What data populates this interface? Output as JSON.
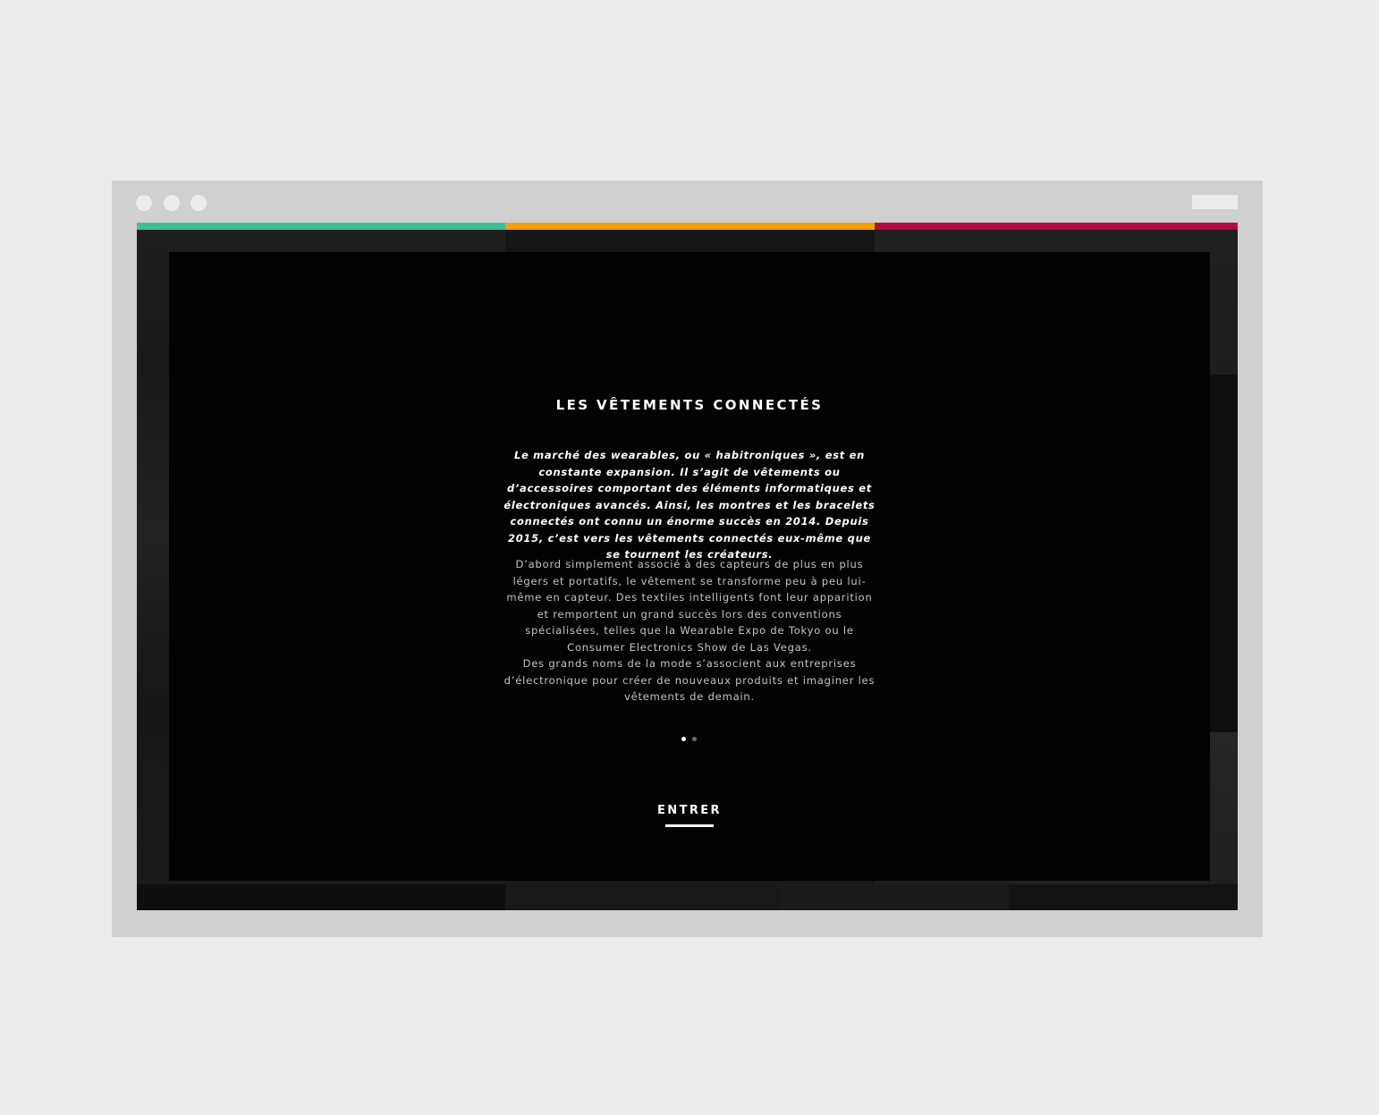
{
  "theme": {
    "bar_colors": [
      "#3dbf96",
      "#f2a007",
      "#b10c44"
    ]
  },
  "modal": {
    "title": "LES VÊTEMENTS CONNECTÉS",
    "intro": "Le marché des wearables, ou « habitroniques », est en constante expansion. Il s’agit de vêtements ou d’accessoires comportant des éléments informatiques et électroniques avancés. Ainsi, les montres et les bracelets connectés ont connu un énorme succès en 2014. Depuis 2015, c’est vers les vêtements connectés eux-même que se tournent les créateurs.",
    "body_paragraph_1": "D’abord simplement associé à des capteurs de plus en plus légers et portatifs, le vêtement se transforme peu à peu lui-même en capteur. Des textiles intelligents font leur apparition et remportent un grand succès lors des conventions spécialisées, telles que la Wearable Expo de Tokyo ou le Consumer Electronics Show de Las Vegas.",
    "body_paragraph_2": "Des grands noms de la mode s’associent aux entreprises d’électronique pour créer de nouveaux produits et imaginer les vêtements de demain.",
    "pager": {
      "total": 2,
      "active": 1
    },
    "enter_label": "ENTRER"
  }
}
